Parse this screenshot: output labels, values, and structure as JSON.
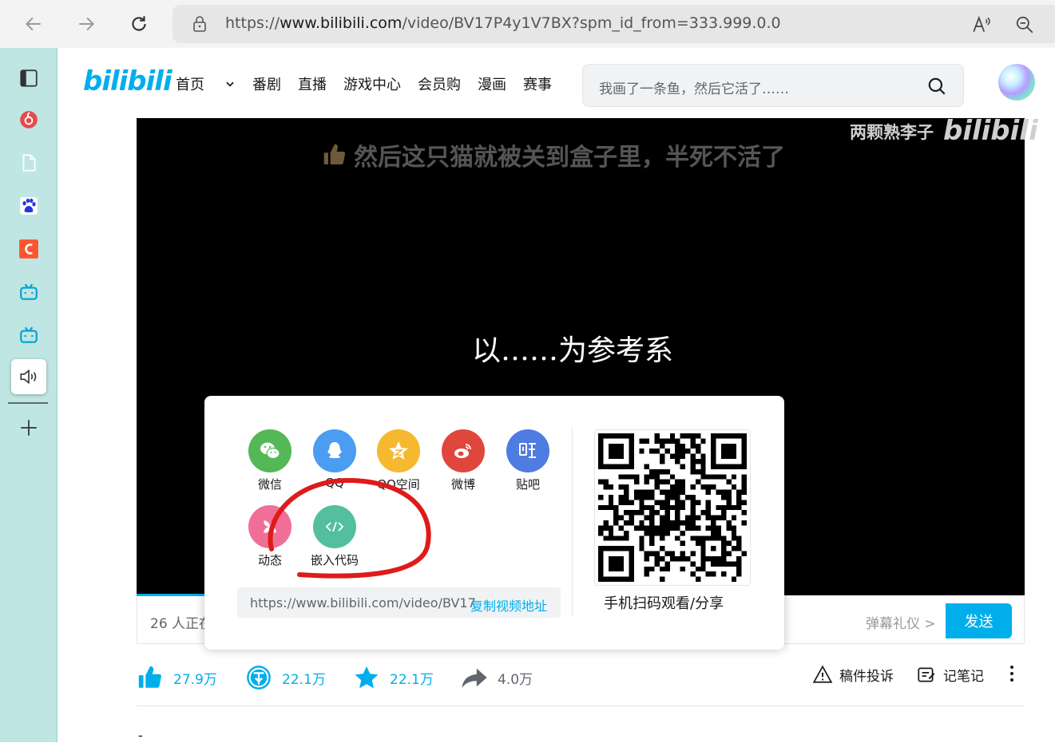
{
  "browser": {
    "url_prefix": "https://",
    "url_host": "www.bilibili.com",
    "url_path": "/video/BV17P4y1V7BX?spm_id_from=333.999.0.0"
  },
  "sidebar": {
    "items": [
      {
        "icon": "tabs-icon"
      },
      {
        "icon": "music-app-icon"
      },
      {
        "icon": "document-icon"
      },
      {
        "icon": "baidu-icon"
      },
      {
        "icon": "csdn-icon"
      },
      {
        "icon": "bilibili-tv-icon"
      },
      {
        "icon": "bilibili-tv-icon"
      },
      {
        "icon": "speaker-icon"
      }
    ],
    "add_icon": "plus-icon"
  },
  "header": {
    "logo": "bilibili",
    "nav": [
      "首页",
      "番剧",
      "直播",
      "游戏中心",
      "会员购",
      "漫画",
      "赛事"
    ],
    "search_placeholder": "我画了一条鱼，然后它活了……"
  },
  "video": {
    "watermark_author": "两颗熟李子",
    "watermark_logo": "bilibili",
    "danmu": "然后这只猫就被关到盒子里，半死不活了",
    "subtitle": "以……为参考系"
  },
  "sendbar": {
    "viewers": "26 人正在",
    "etiquette": "弹幕礼仪 >",
    "send": "发送"
  },
  "share": {
    "items": [
      {
        "label": "微信",
        "color": "#53b855"
      },
      {
        "label": "QQ",
        "color": "#4a9df0"
      },
      {
        "label": "QQ空间",
        "color": "#f5b82e"
      },
      {
        "label": "微博",
        "color": "#e0473c"
      },
      {
        "label": "贴吧",
        "color": "#4f7ce0"
      },
      {
        "label": "动态",
        "color": "#f06f96"
      },
      {
        "label": "嵌入代码",
        "color": "#54bf9d"
      }
    ],
    "link_url": "https://www.bilibili.com/video/BV17",
    "copy_label": "复制视频地址",
    "qr_caption": "手机扫码观看/分享"
  },
  "actions": {
    "like": "27.9万",
    "coin": "22.1万",
    "favorite": "22.1万",
    "share": "4.0万",
    "report": "稿件投诉",
    "notes": "记笔记"
  },
  "footer": {
    "dash": "-"
  },
  "colors": {
    "accent": "#00aeec",
    "annotation": "#e01a1a"
  }
}
